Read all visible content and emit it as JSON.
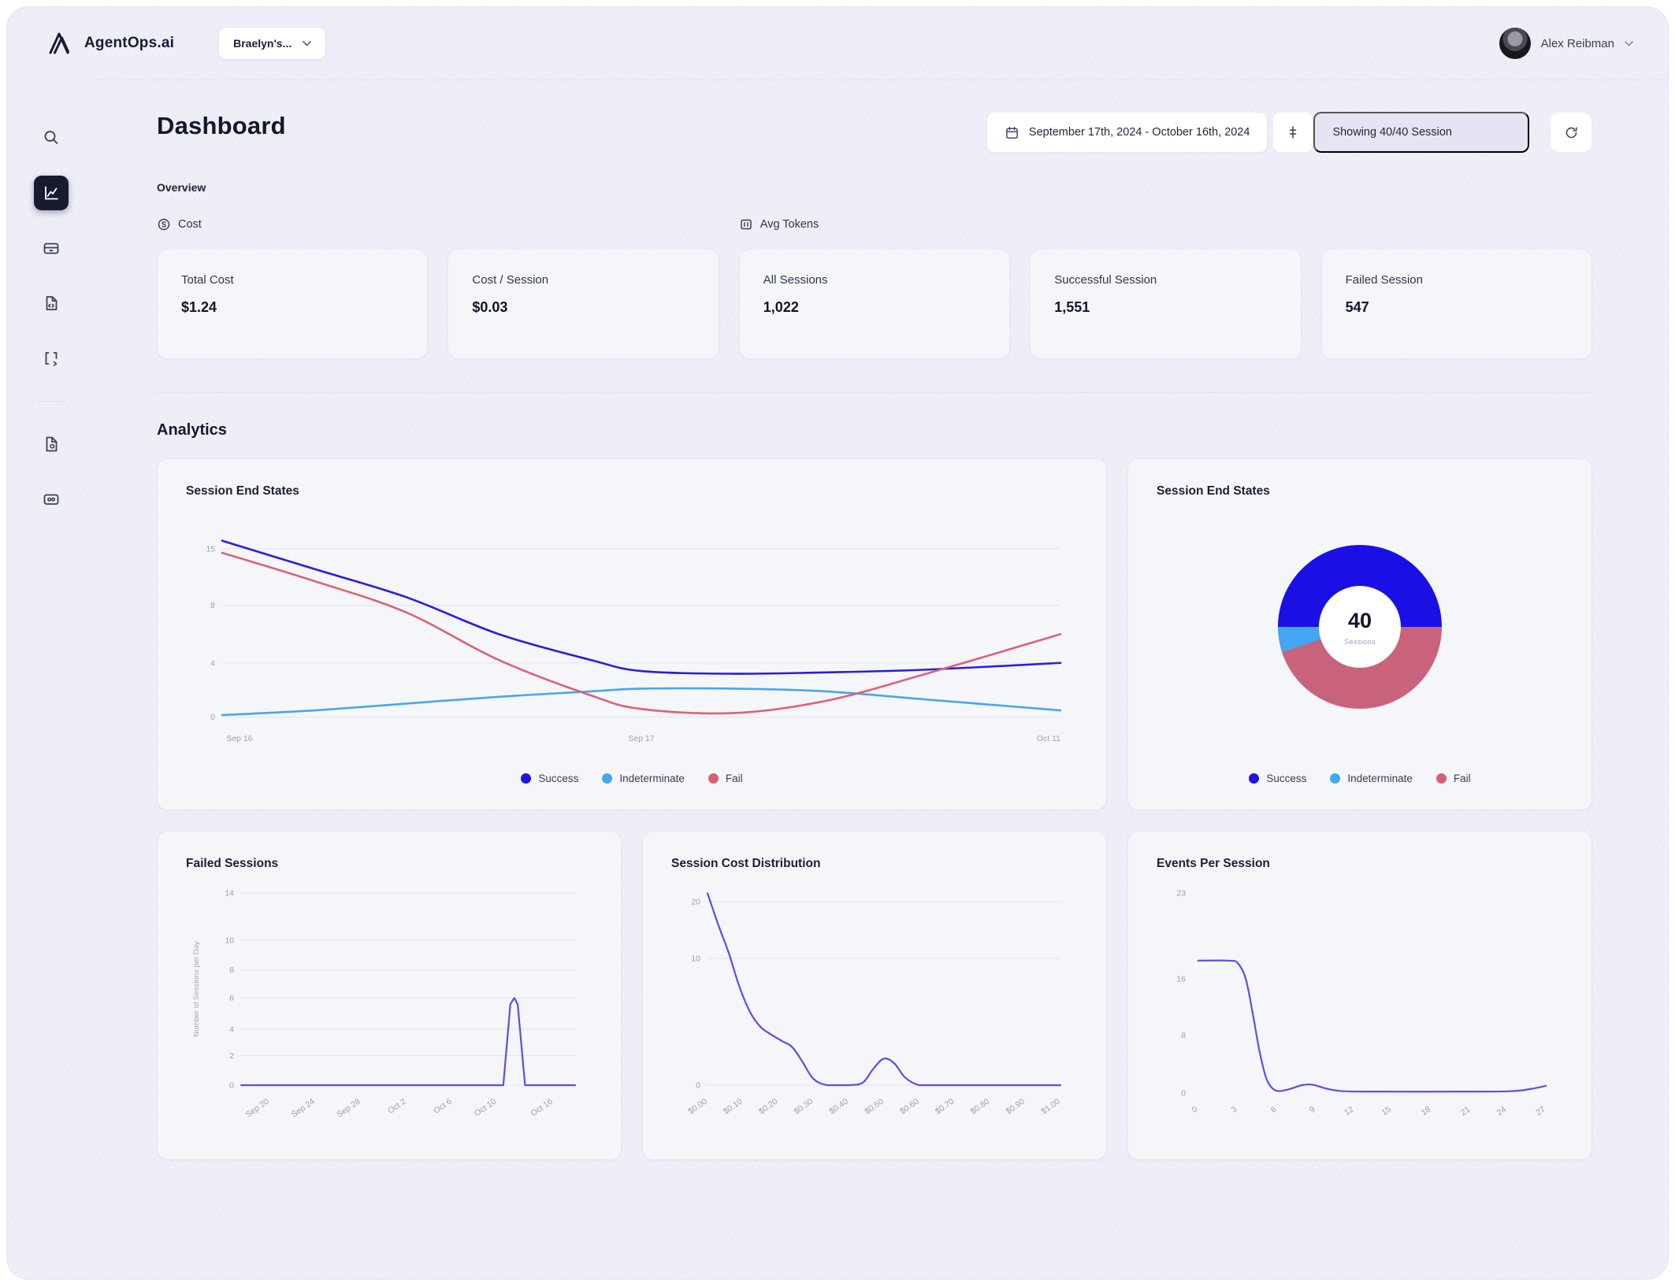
{
  "topbar": {
    "brand": "AgentOps.ai",
    "org_selector": "Braelyn's...",
    "user_name": "Alex Reibman"
  },
  "sidebar": {
    "active_item": "analytics"
  },
  "header": {
    "title": "Dashboard",
    "date_range": "September 17th, 2024 - October 16th, 2024",
    "session_filter": "Showing 40/40 Session"
  },
  "overview": {
    "section_label": "Overview",
    "tabs": [
      {
        "label": "Cost"
      },
      {
        "label": "Avg Tokens"
      }
    ],
    "stats": [
      {
        "label": "Total Cost",
        "value": "$1.24"
      },
      {
        "label": "Cost / Session",
        "value": "$0.03"
      },
      {
        "label": "All Sessions",
        "value": "1,022"
      },
      {
        "label": "Successful Session",
        "value": "1,551"
      },
      {
        "label": "Failed Session",
        "value": "547"
      }
    ]
  },
  "analytics_label": "Analytics",
  "colors": {
    "success": "#1f13e0",
    "indeterminate": "#45a7f0",
    "fail": "#d95f75",
    "purple_line": "#5b4df0"
  },
  "chart_data": [
    {
      "id": "end-states-line",
      "type": "line",
      "title": "Session End States",
      "grid": true,
      "legend_position": "bottom",
      "x_ticks": [
        {
          "label": "Sep 16",
          "f": 0.005,
          "anchor": "start"
        },
        {
          "label": "Sep 17",
          "f": 0.5,
          "anchor": "middle"
        },
        {
          "label": "Oct 11",
          "f": 1.0,
          "anchor": "end"
        }
      ],
      "y_ticks": [
        {
          "v": 15,
          "f": 0.097
        },
        {
          "v": 8,
          "f": 0.389
        },
        {
          "v": 4,
          "f": 0.686
        },
        {
          "v": 0,
          "f": 0.966
        }
      ],
      "series": [
        {
          "name": "Success",
          "color": "#2a1ce4",
          "x": [
            0,
            0.11,
            0.22,
            0.33,
            0.44,
            0.5,
            0.61,
            0.72,
            0.84,
            1
          ],
          "y": [
            16,
            12.5,
            9,
            6,
            4.2,
            3.4,
            3.2,
            3.3,
            3.5,
            4
          ]
        },
        {
          "name": "Indeterminate",
          "color": "#45a7f0",
          "x": [
            0,
            0.11,
            0.22,
            0.33,
            0.44,
            0.5,
            0.61,
            0.72,
            0.84,
            1
          ],
          "y": [
            0.15,
            0.5,
            1.0,
            1.5,
            1.9,
            2.1,
            2.1,
            1.9,
            1.3,
            0.5
          ]
        },
        {
          "name": "Fail",
          "color": "#dd6177",
          "x": [
            0,
            0.11,
            0.22,
            0.33,
            0.44,
            0.5,
            0.61,
            0.72,
            0.84,
            1
          ],
          "y": [
            14.5,
            11,
            7.5,
            4.2,
            1.6,
            0.6,
            0.3,
            1.2,
            3.2,
            6
          ]
        }
      ],
      "legend": [
        {
          "label": "Success",
          "color": "#1f13e0"
        },
        {
          "label": "Indeterminate",
          "color": "#45a7f0"
        },
        {
          "label": "Fail",
          "color": "#d95f75"
        }
      ]
    },
    {
      "id": "end-states-donut",
      "type": "donut",
      "title": "Session End States",
      "center_value": "40",
      "center_label": "Sessions",
      "start_deg": 270,
      "slices": [
        {
          "name": "Success",
          "value": 20,
          "color": "#1a10e6"
        },
        {
          "name": "Fail",
          "value": 18,
          "color": "#c9637b"
        },
        {
          "name": "Indeterminate",
          "value": 2,
          "color": "#44a6f2"
        }
      ],
      "legend": [
        {
          "label": "Success",
          "color": "#1f13e0"
        },
        {
          "label": "Indeterminate",
          "color": "#45a7f0"
        },
        {
          "label": "Fail",
          "color": "#d95f75"
        }
      ]
    },
    {
      "id": "failed-sessions",
      "type": "line",
      "title": "Failed Sessions",
      "ylabel": "Number of Sessions per Day",
      "grid": true,
      "x_rotate": true,
      "x_ticks": [
        {
          "label": "Sep 20",
          "f": 0.085
        },
        {
          "label": "Sep 24",
          "f": 0.222
        },
        {
          "label": "Sep 28",
          "f": 0.358
        },
        {
          "label": "Oct 2",
          "f": 0.495
        },
        {
          "label": "Oct 6",
          "f": 0.632
        },
        {
          "label": "Oct 10",
          "f": 0.765
        },
        {
          "label": "Oct 16",
          "f": 0.934
        }
      ],
      "y_ticks": [
        {
          "v": 14,
          "f": 0
        },
        {
          "v": 10,
          "f": 0.246
        },
        {
          "v": 8,
          "f": 0.4
        },
        {
          "v": 6,
          "f": 0.546
        },
        {
          "v": 4,
          "f": 0.708
        },
        {
          "v": 2,
          "f": 0.846
        },
        {
          "v": 0,
          "f": 1
        }
      ],
      "series": [
        {
          "name": "Failed Sessions",
          "color": "#5b4df0",
          "smooth": false,
          "x": [
            0,
            0.785,
            0.806,
            0.818,
            0.828,
            0.85,
            1
          ],
          "y": [
            0,
            0,
            5.6,
            6,
            5.6,
            0,
            0
          ]
        }
      ]
    },
    {
      "id": "session-cost",
      "type": "line",
      "title": "Session Cost Distribution",
      "grid": true,
      "x_rotate": true,
      "x_ticks": [
        {
          "label": "$0.00",
          "f": 0
        },
        {
          "label": "$0.10",
          "f": 0.1
        },
        {
          "label": "$0.20",
          "f": 0.2
        },
        {
          "label": "$0.30",
          "f": 0.3
        },
        {
          "label": "$0.40",
          "f": 0.4
        },
        {
          "label": "$0.50",
          "f": 0.5
        },
        {
          "label": "$0.60",
          "f": 0.6
        },
        {
          "label": "$0.70",
          "f": 0.7
        },
        {
          "label": "$0.80",
          "f": 0.8
        },
        {
          "label": "$0.90",
          "f": 0.9
        },
        {
          "label": "$1.00",
          "f": 1
        }
      ],
      "y_ticks": [
        {
          "v": 20,
          "f": 0.045
        },
        {
          "v": 10,
          "f": 0.34
        },
        {
          "v": 0,
          "f": 1
        }
      ],
      "series": [
        {
          "name": "Sessions",
          "color": "#5b4df0",
          "x": [
            0,
            0.03,
            0.06,
            0.09,
            0.12,
            0.15,
            0.18,
            0.21,
            0.24,
            0.27,
            0.3,
            0.34,
            0.4,
            0.44,
            0.47,
            0.5,
            0.53,
            0.56,
            0.6,
            0.66,
            0.75,
            0.88,
            1
          ],
          "y": [
            21.5,
            16,
            11,
            7.8,
            5.8,
            4.6,
            4.0,
            3.5,
            3.0,
            1.8,
            0.5,
            0,
            0,
            0.2,
            1.3,
            2.1,
            1.7,
            0.6,
            0,
            0,
            0,
            0,
            0
          ]
        }
      ]
    },
    {
      "id": "events-per-session",
      "type": "line",
      "title": "Events Per Session",
      "grid": false,
      "x_rotate": true,
      "x_ticks": [
        {
          "label": "0",
          "f": 0.015
        },
        {
          "label": "3",
          "f": 0.126
        },
        {
          "label": "6",
          "f": 0.238
        },
        {
          "label": "9",
          "f": 0.348
        },
        {
          "label": "12",
          "f": 0.457
        },
        {
          "label": "15",
          "f": 0.563
        },
        {
          "label": "18",
          "f": 0.675
        },
        {
          "label": "21",
          "f": 0.787
        },
        {
          "label": "24",
          "f": 0.889
        },
        {
          "label": "27",
          "f": 1
        }
      ],
      "y_ticks": [
        {
          "v": 23,
          "f": 0
        },
        {
          "v": 16,
          "f": 0.43
        },
        {
          "v": 8,
          "f": 0.71
        },
        {
          "v": 0,
          "f": 1
        }
      ],
      "series": [
        {
          "name": "Events",
          "color": "#5b4df0",
          "x": [
            0.015,
            0.1,
            0.127,
            0.15,
            0.17,
            0.19,
            0.21,
            0.235,
            0.27,
            0.31,
            0.34,
            0.38,
            0.43,
            0.55,
            0.75,
            0.9,
            0.96,
            1
          ],
          "y": [
            17.5,
            17.5,
            17.3,
            16,
            11,
            5.5,
            1.8,
            0.35,
            0.5,
            1.1,
            1.15,
            0.6,
            0.25,
            0.2,
            0.2,
            0.25,
            0.6,
            1.0
          ]
        }
      ]
    }
  ]
}
